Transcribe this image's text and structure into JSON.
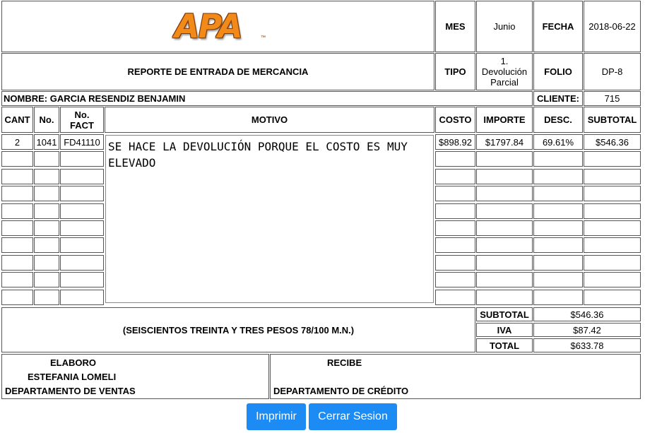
{
  "header": {
    "logo_text": "APA",
    "logo_tm": "™",
    "mes_label": "MES",
    "mes_value": "Junio",
    "fecha_label": "FECHA",
    "fecha_value": "2018-06-22",
    "title": "REPORTE DE ENTRADA DE MERCANCIA",
    "tipo_label": "TIPO",
    "tipo_value": "1. Devolución Parcial",
    "folio_label": "FOLIO",
    "folio_value": "DP-8",
    "nombre": "NOMBRE: GARCIA RESENDIZ BENJAMIN",
    "cliente_label": "CLIENTE:",
    "cliente_value": "715"
  },
  "table": {
    "columns": [
      "CANT",
      "No.",
      "No. FACT",
      "MOTIVO",
      "COSTO",
      "IMPORTE",
      "DESC.",
      "SUBTOTAL"
    ],
    "row": {
      "cant": "2",
      "no": "1041",
      "fact": "FD41110",
      "motivo": "SE HACE LA DEVOLUCIÓN PORQUE EL COSTO ES MUY ELEVADO",
      "costo": "$898.92",
      "importe": "$1797.84",
      "desc": "69.61%",
      "subtotal": "$546.36"
    }
  },
  "totals": {
    "amount_words": "(SEISCIENTOS TREINTA Y TRES PESOS 78/100 M.N.)",
    "subtotal_label": "SUBTOTAL",
    "subtotal_value": "$546.36",
    "iva_label": "IVA",
    "iva_value": "$87.42",
    "total_label": "TOTAL",
    "total_value": "$633.78"
  },
  "signatures": {
    "elaboro_label": "ELABORO",
    "elaboro_name": "ESTEFANIA LOMELI",
    "elaboro_dept": "DEPARTAMENTO DE VENTAS",
    "recibe_label": "RECIBE",
    "recibe_dept": "DEPARTAMENTO DE CRÉDITO"
  },
  "buttons": {
    "print": "Imprimir",
    "logout": "Cerrar Sesion"
  },
  "colors": {
    "button": "#1c8cf4",
    "logo_orange": "#f28a1a",
    "logo_outline": "#7a3a08"
  }
}
